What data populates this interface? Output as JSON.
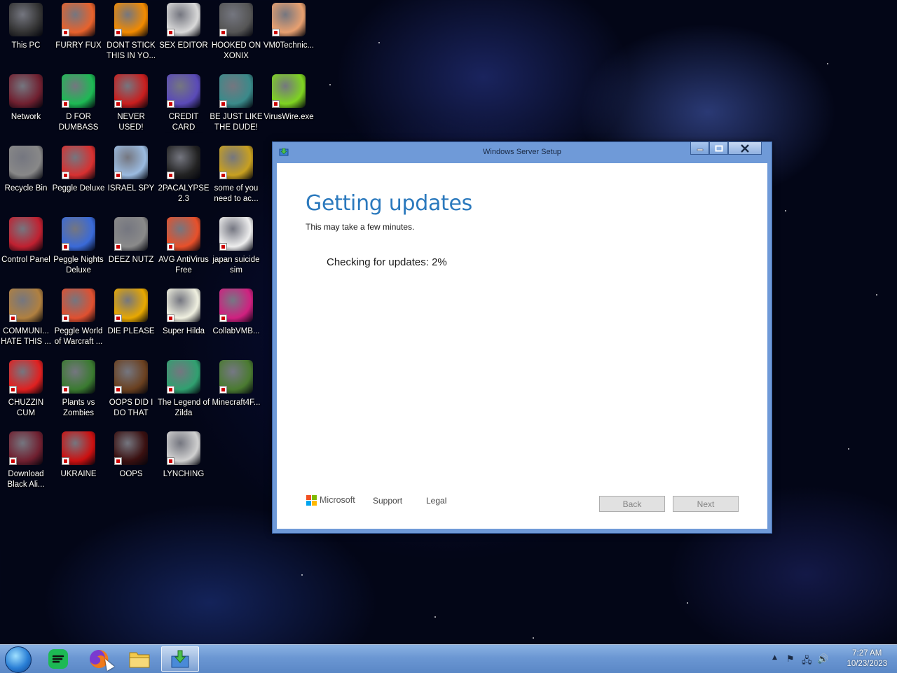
{
  "desktop": {
    "icons": [
      {
        "label": "This PC",
        "icon": "computer-icon",
        "color": "#333333"
      },
      {
        "label": "FURRY FUX",
        "icon": "firefox-icon",
        "color": "#e8622c"
      },
      {
        "label": "DONT STICK THIS IN YO...",
        "icon": "vlc-icon",
        "color": "#f28a00"
      },
      {
        "label": "SEX EDITOR",
        "icon": "hex-editor-icon",
        "color": "#d9d9d9"
      },
      {
        "label": "HOOKED ON XONIX",
        "icon": "xonix-icon",
        "color": "#555555"
      },
      {
        "label": "VM0Technic...",
        "icon": "doctor-icon",
        "color": "#e8a070"
      },
      {
        "label": "Network",
        "icon": "network-icon",
        "color": "#702030"
      },
      {
        "label": "D FOR DUMBASS",
        "icon": "notes-icon",
        "color": "#1db954"
      },
      {
        "label": "NEVER USED!",
        "icon": "devcpp-icon",
        "color": "#c81e1e"
      },
      {
        "label": "CREDIT CARD CHECKER",
        "icon": "credit-card-icon",
        "color": "#5a4ab8"
      },
      {
        "label": "BE JUST LIKE THE DUDE!",
        "icon": "dude-icon",
        "color": "#3a8a8a"
      },
      {
        "label": "VirusWire.exe",
        "icon": "limewire-icon",
        "color": "#7ed321"
      },
      {
        "label": "Recycle Bin",
        "icon": "recycle-bin-icon",
        "color": "#888888"
      },
      {
        "label": "Peggle Deluxe",
        "icon": "peggle-icon",
        "color": "#d83030"
      },
      {
        "label": "ISRAEL SPY",
        "icon": "spy-icon",
        "color": "#9bbbe0"
      },
      {
        "label": "2PACALYPSE 2.3",
        "icon": "terminal-icon",
        "color": "#222222"
      },
      {
        "label": "some of you need to ac...",
        "icon": "beaver-icon",
        "color": "#c8a020"
      },
      {
        "label": "",
        "icon": "",
        "color": ""
      },
      {
        "label": "Control Panel",
        "icon": "control-panel-icon",
        "color": "#c02030"
      },
      {
        "label": "Peggle Nights Deluxe",
        "icon": "peggle-nights-icon",
        "color": "#3a6ad8"
      },
      {
        "label": "DEEZ NUTZ",
        "icon": "windows-stack-icon",
        "color": "#8a8a8a"
      },
      {
        "label": "AVG AntiVirus Free",
        "icon": "avg-icon",
        "color": "#e8502a"
      },
      {
        "label": "japan suicide sim",
        "icon": "document-icon",
        "color": "#eeeeee"
      },
      {
        "label": "",
        "icon": "",
        "color": ""
      },
      {
        "label": "COMMUNI... HATE THIS ...",
        "icon": "money-bag-icon",
        "color": "#b08040"
      },
      {
        "label": "Peggle World of Warcraft ...",
        "icon": "peggle-wow-icon",
        "color": "#e05030"
      },
      {
        "label": "DIE PLEASE",
        "icon": "de-icon",
        "color": "#e8a800"
      },
      {
        "label": "Super Hilda",
        "icon": "pixel-cat-icon",
        "color": "#f0f0e0"
      },
      {
        "label": "CollabVMB...",
        "icon": "monitor-icon",
        "color": "#d02080"
      },
      {
        "label": "",
        "icon": "",
        "color": ""
      },
      {
        "label": "CHUZZIN CUM",
        "icon": "chuzzle-icon",
        "color": "#e02020"
      },
      {
        "label": "Plants vs Zombies",
        "icon": "flower-icon",
        "color": "#3a7a30"
      },
      {
        "label": "OOPS DID I DO THAT",
        "icon": "portrait-icon",
        "color": "#6a4020"
      },
      {
        "label": "The Legend of Zilda",
        "icon": "zilda-icon",
        "color": "#30a070"
      },
      {
        "label": "Minecraft4F...",
        "icon": "grass-block-icon",
        "color": "#4a7a30"
      },
      {
        "label": "",
        "icon": "",
        "color": ""
      },
      {
        "label": "Download Black Ali...",
        "icon": "network-icon",
        "color": "#702030"
      },
      {
        "label": "UKRAINE",
        "icon": "radiation-icon",
        "color": "#cc1010"
      },
      {
        "label": "OOPS",
        "icon": "oops-icon",
        "color": "#3a1010"
      },
      {
        "label": "LYNCHING",
        "icon": "lynching-icon",
        "color": "#d0d0d0"
      }
    ]
  },
  "window": {
    "title": "Windows Server Setup",
    "heading": "Getting updates",
    "subtext": "This may take a few minutes.",
    "progress_text": "Checking for updates: 2%",
    "progress_percent": 2,
    "brand": "Microsoft",
    "support_link": "Support",
    "legal_link": "Legal",
    "back_label": "Back",
    "next_label": "Next",
    "accent_color": "#2b79bd"
  },
  "taskbar": {
    "items": [
      {
        "name": "spotify-icon",
        "color": "#1db954"
      },
      {
        "name": "firefox-icon",
        "color": "#e8622c"
      },
      {
        "name": "file-explorer-icon",
        "color": "#f0c040"
      },
      {
        "name": "setup-icon",
        "color": "#3aa040"
      }
    ],
    "time": "7:27 AM",
    "date": "10/23/2023"
  }
}
